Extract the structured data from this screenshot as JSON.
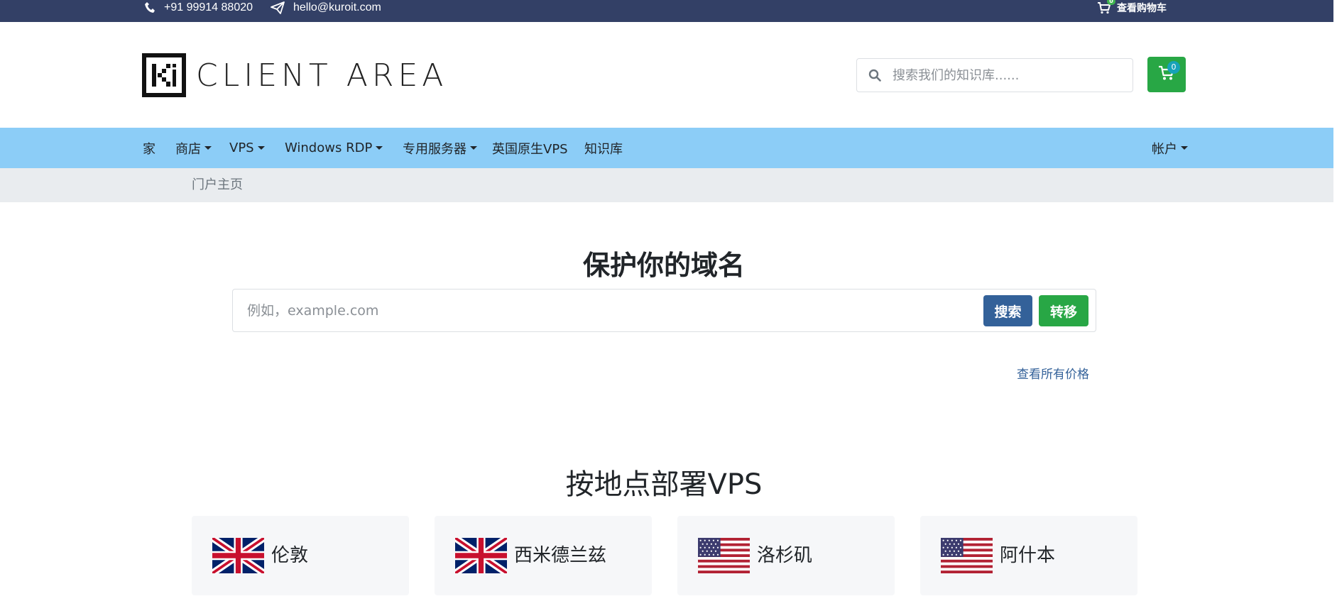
{
  "topbar": {
    "phone": "+91 99914 88020",
    "email": "hello@kuroit.com",
    "cart_label": "查看购物车",
    "cart_count": "0"
  },
  "header": {
    "logo_text": "CLIENT AREA",
    "kb_search_placeholder": "搜索我们的知识库......",
    "cart_count": "0",
    "accent_color": "#28a745"
  },
  "nav": {
    "items": [
      {
        "label": "家"
      },
      {
        "label": "商店"
      },
      {
        "label": "VPS"
      },
      {
        "label": "Windows RDP"
      },
      {
        "label": "专用服务器"
      },
      {
        "label": "英国原生VPS"
      },
      {
        "label": "知识库"
      }
    ],
    "account": "帐户",
    "background_color": "#8ccdf7"
  },
  "breadcrumb": {
    "current": "门户主页"
  },
  "domain": {
    "title": "保护你的域名",
    "placeholder": "例如，example.com",
    "search_button": "搜索",
    "transfer_button": "转移",
    "all_prices_link": "查看所有价格"
  },
  "locations": {
    "title": "按地点部署VPS",
    "cards": [
      {
        "name": "伦敦",
        "flag": "uk-flag"
      },
      {
        "name": "西米德兰兹",
        "flag": "uk-flag"
      },
      {
        "name": "洛杉矶",
        "flag": "us-flag"
      },
      {
        "name": "阿什本",
        "flag": "us-flag"
      }
    ]
  }
}
